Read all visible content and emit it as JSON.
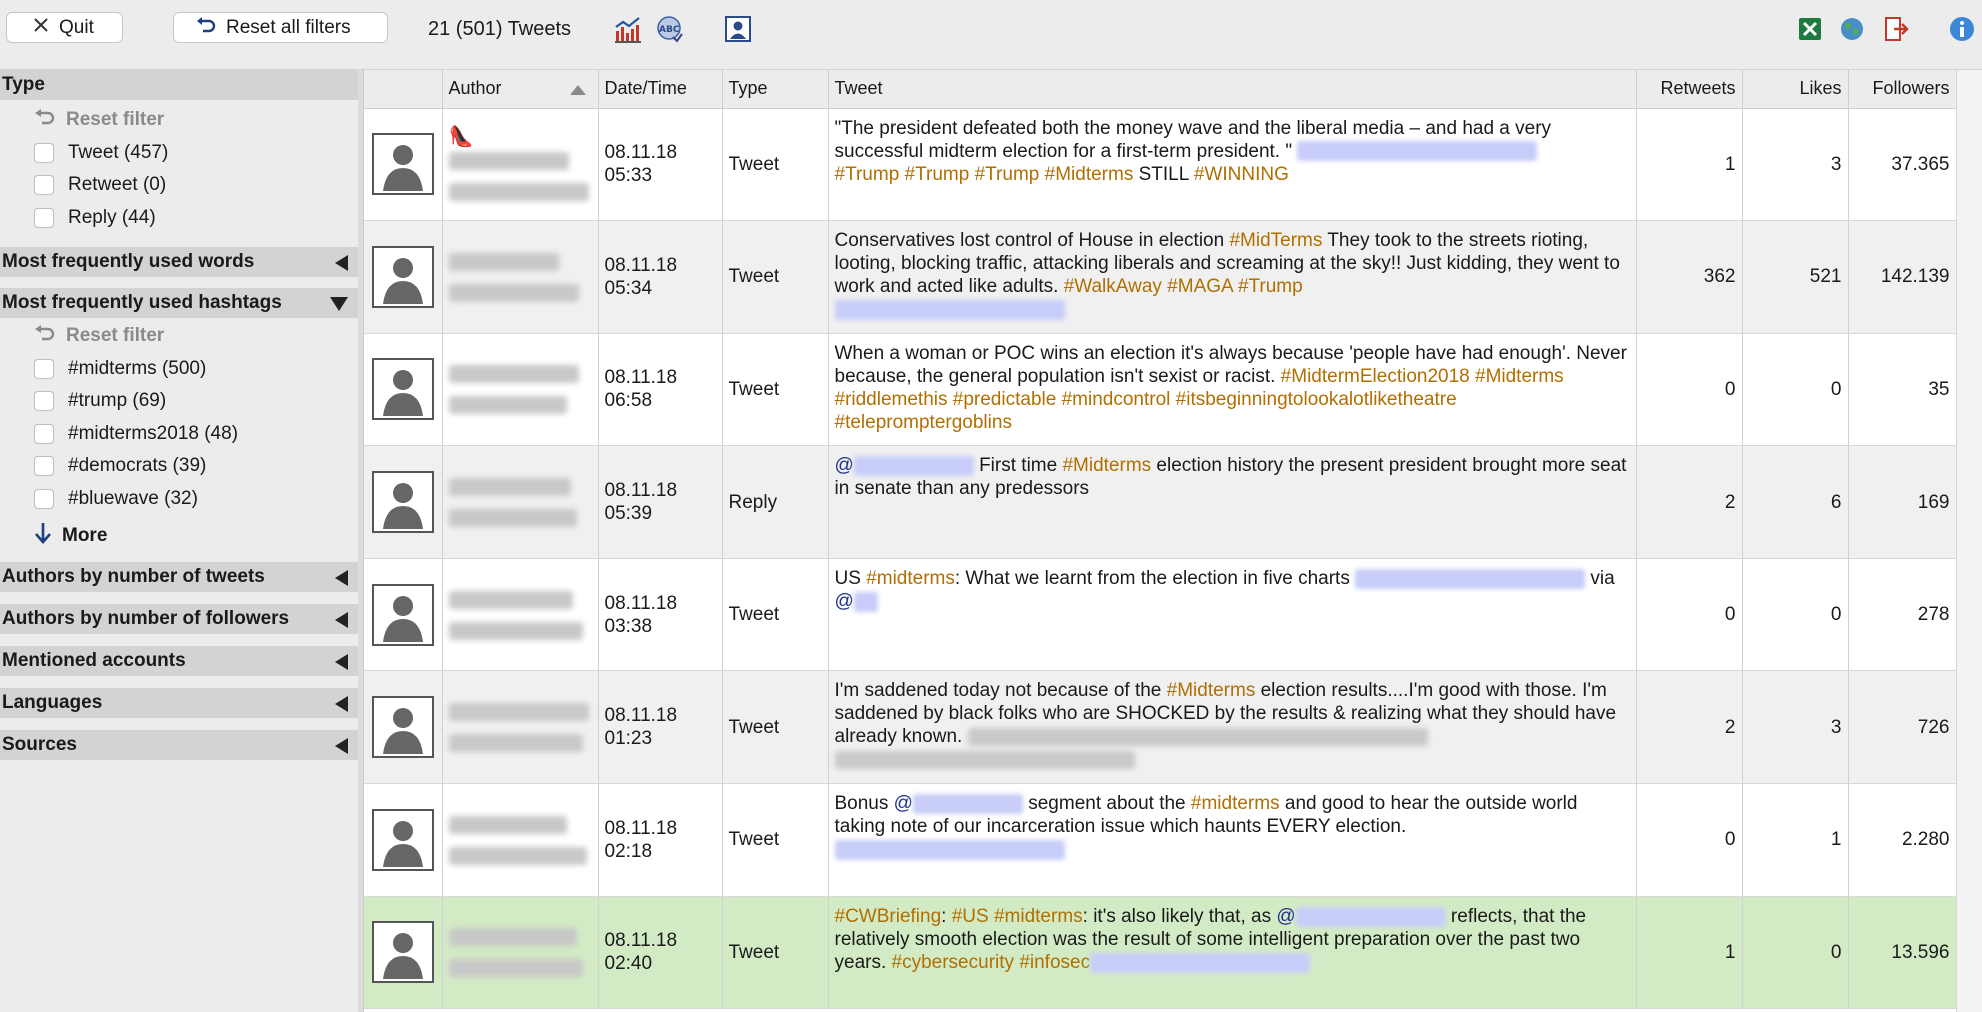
{
  "toolbar": {
    "quit_label": "Quit",
    "reset_label": "Reset all filters",
    "tweet_count": "21 (501) Tweets"
  },
  "sidebar": {
    "type_header": "Type",
    "type_reset": "Reset filter",
    "type_items": [
      "Tweet (457)",
      "Retweet (0)",
      "Reply (44)"
    ],
    "words_header": "Most frequently used words",
    "hashtags_header": "Most frequently used hashtags",
    "hashtags_reset": "Reset filter",
    "hashtag_items": [
      "#midterms (500)",
      "#trump (69)",
      "#midterms2018 (48)",
      "#democrats (39)",
      "#bluewave (32)"
    ],
    "more_label": "More",
    "authors_tweets_header": "Authors by number of tweets",
    "authors_followers_header": "Authors by number of followers",
    "mentioned_header": "Mentioned accounts",
    "languages_header": "Languages",
    "sources_header": "Sources"
  },
  "table": {
    "columns": [
      "",
      "Author",
      "Date/Time",
      "Type",
      "Tweet",
      "Retweets",
      "Likes",
      "Followers"
    ],
    "rows": [
      {
        "date": "08.11.18",
        "time": "05:33",
        "type": "Tweet",
        "parts": [
          [
            "t",
            "\"The president defeated both the money wave and the liberal media – and had a very successful midterm election for a first-term president. \" "
          ],
          [
            "l",
            240
          ],
          [
            "br",
            ""
          ],
          [
            "h",
            "#Trump"
          ],
          [
            "t",
            " "
          ],
          [
            "h",
            "#Trump"
          ],
          [
            "t",
            " "
          ],
          [
            "h",
            "#Trump"
          ],
          [
            "t",
            " "
          ],
          [
            "h",
            "#Midterms"
          ],
          [
            "t",
            " STILL "
          ],
          [
            "h",
            "#WINNING"
          ]
        ],
        "retweets": "1",
        "likes": "3",
        "followers": "37.365",
        "style": "odd"
      },
      {
        "date": "08.11.18",
        "time": "05:34",
        "type": "Tweet",
        "parts": [
          [
            "t",
            "Conservatives lost control of House in election "
          ],
          [
            "h",
            "#MidTerms"
          ],
          [
            "t",
            " They took to the streets rioting, looting, blocking traffic, attacking liberals and screaming at the sky!! Just kidding, they went to work and acted like adults. "
          ],
          [
            "h",
            "#WalkAway"
          ],
          [
            "t",
            " "
          ],
          [
            "h",
            "#MAGA"
          ],
          [
            "t",
            " "
          ],
          [
            "h",
            "#Trump"
          ],
          [
            "br",
            ""
          ],
          [
            "l",
            230
          ]
        ],
        "retweets": "362",
        "likes": "521",
        "followers": "142.139",
        "style": "even"
      },
      {
        "date": "08.11.18",
        "time": "06:58",
        "type": "Tweet",
        "parts": [
          [
            "t",
            "When a woman or POC wins an election it's always because 'people have had enough'. Never because, the general population isn't sexist or racist. "
          ],
          [
            "h",
            "#MidtermElection2018"
          ],
          [
            "t",
            " "
          ],
          [
            "h",
            "#Midterms"
          ],
          [
            "t",
            " "
          ],
          [
            "h",
            "#riddlemethis"
          ],
          [
            "t",
            " "
          ],
          [
            "h",
            "#predictable"
          ],
          [
            "t",
            " "
          ],
          [
            "h",
            "#mindcontrol"
          ],
          [
            "t",
            " "
          ],
          [
            "h",
            "#itsbeginningtolookalotliketheatre"
          ],
          [
            "t",
            " "
          ],
          [
            "h",
            "#telepromptergoblins"
          ]
        ],
        "retweets": "0",
        "likes": "0",
        "followers": "35",
        "style": "odd"
      },
      {
        "date": "08.11.18",
        "time": "05:39",
        "type": "Reply",
        "parts": [
          [
            "m",
            "@"
          ],
          [
            "l",
            120
          ],
          [
            "t",
            " First time "
          ],
          [
            "h",
            "#Midterms"
          ],
          [
            "t",
            " election history the present president brought more seat in senate than any predessors"
          ]
        ],
        "retweets": "2",
        "likes": "6",
        "followers": "169",
        "style": "even"
      },
      {
        "date": "08.11.18",
        "time": "03:38",
        "type": "Tweet",
        "parts": [
          [
            "t",
            "US "
          ],
          [
            "h",
            "#midterms"
          ],
          [
            "t",
            ": What we learnt from the election in five charts "
          ],
          [
            "l",
            230
          ],
          [
            "t",
            " via "
          ],
          [
            "m",
            "@"
          ],
          [
            "l",
            24
          ]
        ],
        "retweets": "0",
        "likes": "0",
        "followers": "278",
        "style": "odd"
      },
      {
        "date": "08.11.18",
        "time": "01:23",
        "type": "Tweet",
        "parts": [
          [
            "t",
            "I'm saddened today not because of the "
          ],
          [
            "h",
            "#Midterms"
          ],
          [
            "t",
            " election results....I'm good with those. I'm saddened by black folks who are SHOCKED by the results & realizing what they should have already known. "
          ],
          [
            "g",
            460
          ],
          [
            "g",
            300
          ]
        ],
        "retweets": "2",
        "likes": "3",
        "followers": "726",
        "style": "even"
      },
      {
        "date": "08.11.18",
        "time": "02:18",
        "type": "Tweet",
        "parts": [
          [
            "t",
            "Bonus "
          ],
          [
            "m",
            "@"
          ],
          [
            "l",
            110
          ],
          [
            "t",
            " segment about the "
          ],
          [
            "h",
            "#midterms"
          ],
          [
            "t",
            " and good to hear the outside world taking note of our incarceration issue which haunts EVERY election."
          ],
          [
            "br",
            ""
          ],
          [
            "l",
            230
          ]
        ],
        "retweets": "0",
        "likes": "1",
        "followers": "2.280",
        "style": "odd"
      },
      {
        "date": "08.11.18",
        "time": "02:40",
        "type": "Tweet",
        "parts": [
          [
            "h",
            "#CWBriefing"
          ],
          [
            "t",
            ": "
          ],
          [
            "h",
            "#US"
          ],
          [
            "t",
            " "
          ],
          [
            "h",
            "#midterms"
          ],
          [
            "t",
            ": it's also likely that, as "
          ],
          [
            "m",
            "@"
          ],
          [
            "l",
            150
          ],
          [
            "t",
            " reflects, that the relatively smooth election was the result of some intelligent preparation over the past two years. "
          ],
          [
            "h",
            "#cybersecurity"
          ],
          [
            "t",
            " "
          ],
          [
            "h",
            "#infosec"
          ],
          [
            "l",
            220
          ]
        ],
        "retweets": "1",
        "likes": "0",
        "followers": "13.596",
        "style": "sel"
      }
    ]
  }
}
